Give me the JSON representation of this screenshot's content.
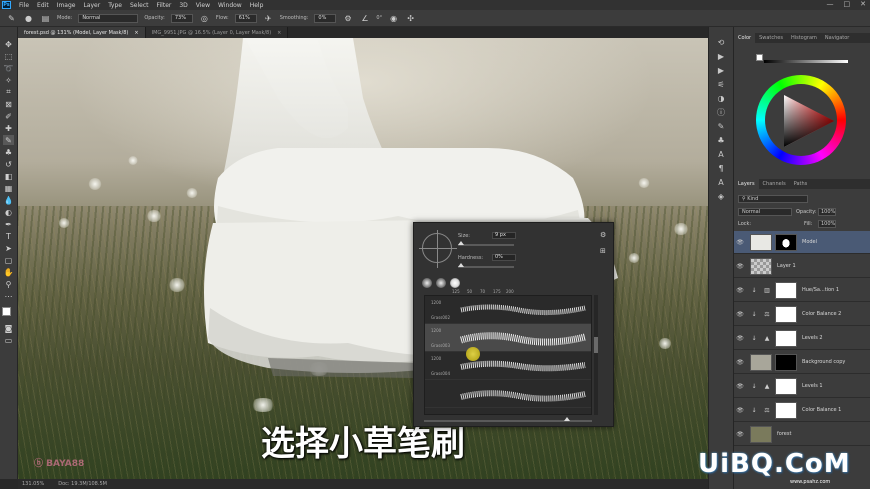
{
  "menubar": {
    "logo": "Ps",
    "items": [
      "File",
      "Edit",
      "Image",
      "Layer",
      "Type",
      "Select",
      "Filter",
      "3D",
      "View",
      "Window",
      "Help"
    ],
    "win_controls": [
      "—",
      "□",
      "✕"
    ]
  },
  "options": {
    "mode_label": "Mode:",
    "mode_value": "Normal",
    "opacity_label": "Opacity:",
    "opacity_value": "73%",
    "flow_label": "Flow:",
    "flow_value": "61%",
    "smoothing_label": "Smoothing:",
    "smoothing_value": "0%",
    "angle_value": "0°"
  },
  "tabs": [
    {
      "label": "forest.psd @ 131% (Model, Layer Mask/8)",
      "close": "×"
    },
    {
      "label": "IMG_9951.JPG @ 16.5% (Layer 0, Layer Mask/8)",
      "close": "×"
    }
  ],
  "canvas": {
    "subtitle": "选择小草笔刷",
    "watermark_left": "ⓑ BAYA88"
  },
  "brush_panel": {
    "size_label": "Size:",
    "size_value": "9 px",
    "hardness_label": "Hardness:",
    "hardness_value": "0%",
    "hardness_level": 0,
    "preset_sizes": [
      "125",
      "50",
      "70",
      "175",
      "200"
    ],
    "brushes": [
      {
        "num": "1200",
        "name": "Grass002"
      },
      {
        "num": "1200",
        "name": "Grass003"
      },
      {
        "num": "1200",
        "name": "Grass004"
      },
      {
        "num": "",
        "name": ""
      }
    ]
  },
  "status": {
    "zoom": "131.05%",
    "doc": "Doc: 19.3M/108.5M"
  },
  "color_panel": {
    "tabs": [
      "Color",
      "Swatches",
      "Histogram",
      "Navigator"
    ],
    "active_tab": "Color"
  },
  "layers_panel": {
    "tabs": [
      "Layers",
      "Channels",
      "Paths"
    ],
    "kind_label": "Kind",
    "blend_mode": "Normal",
    "opacity_label": "Opacity:",
    "opacity_value": "100%",
    "lock_label": "Lock:",
    "fill_label": "Fill:",
    "fill_value": "100%",
    "layers": [
      {
        "name": "Model",
        "selected": true,
        "type": "masked"
      },
      {
        "name": "Layer 1",
        "selected": false,
        "type": "plain"
      },
      {
        "name": "Hue/Sa...tion 1",
        "selected": false,
        "type": "adjust"
      },
      {
        "name": "Color Balance 2",
        "selected": false,
        "type": "adjust"
      },
      {
        "name": "Levels 2",
        "selected": false,
        "type": "adjust"
      },
      {
        "name": "Background copy",
        "selected": false,
        "type": "image-black"
      },
      {
        "name": "Levels 1",
        "selected": false,
        "type": "adjust"
      },
      {
        "name": "Color Balance 1",
        "selected": false,
        "type": "adjust"
      },
      {
        "name": "forest",
        "selected": false,
        "type": "image"
      }
    ]
  },
  "brand": {
    "logo": "UiBQ.CoM",
    "sub": "www.psahz.com"
  },
  "colors": {
    "accent": "#31a8ff",
    "selected_layer": "#4a5a75",
    "cursor": "#f2e34a"
  }
}
